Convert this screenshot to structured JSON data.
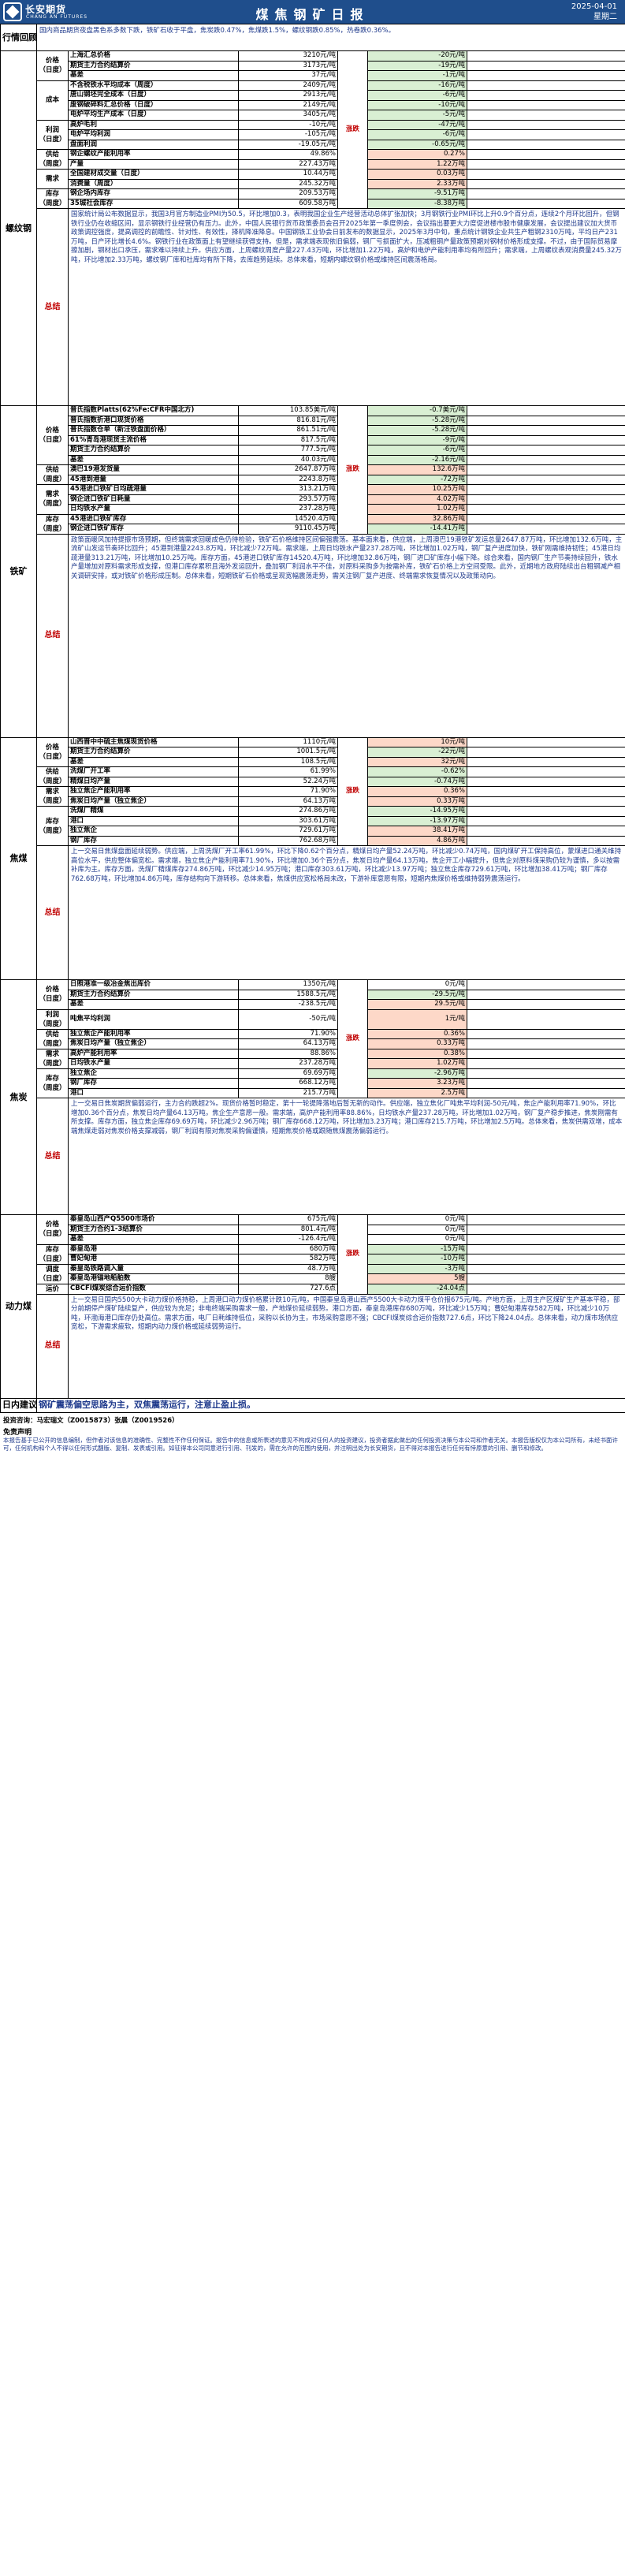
{
  "header": {
    "brand_cn": "长安期货",
    "brand_en": "CHANG AN FUTURES",
    "title": "煤焦钢矿日报",
    "date": "2025-04-01",
    "weekday": "星期二"
  },
  "review": {
    "label": "行情回顾",
    "text": "国内商品期货夜盘黑色系多数下跌，铁矿石收于平盘，焦炭跌0.47%，焦煤跌1.5%，螺纹钢跌0.85%，热卷跌0.36%。"
  },
  "sections": [
    {
      "name": "螺纹钢",
      "groups": [
        {
          "label": "价格\n（日度）",
          "rows": [
            {
              "ind": "上海汇总价格",
              "val": "3210元/吨",
              "chg": "-20元/吨",
              "dir": "down"
            },
            {
              "ind": "期货主力合约结算价",
              "val": "3173元/吨",
              "chg": "-19元/吨",
              "dir": "down"
            },
            {
              "ind": "基差",
              "val": "37元/吨",
              "chg": "-1元/吨",
              "dir": "down"
            }
          ]
        },
        {
          "label": "成本",
          "rows": [
            {
              "ind": "不含税铁水平均成本（周度）",
              "val": "2409元/吨",
              "chg": "-16元/吨",
              "dir": "down"
            },
            {
              "ind": "唐山钢坯完全成本（日度）",
              "val": "2913元/吨",
              "chg": "-6元/吨",
              "dir": "down"
            },
            {
              "ind": "废钢破碎料汇总价格（日度）",
              "val": "2149元/吨",
              "chg": "-10元/吨",
              "dir": "down"
            },
            {
              "ind": "电炉平均生产成本（日度）",
              "val": "3405元/吨",
              "chg": "-5元/吨",
              "dir": "down"
            }
          ]
        },
        {
          "label": "利润\n（日度）",
          "rows": [
            {
              "ind": "高炉毛利",
              "val": "-10元/吨",
              "chg": "-47元/吨",
              "dir": "down"
            },
            {
              "ind": "电炉平均利润",
              "val": "-105元/吨",
              "chg": "-6元/吨",
              "dir": "down"
            },
            {
              "ind": "盘面利润",
              "val": "-19.05元/吨",
              "chg": "-0.65元/吨",
              "dir": "down"
            }
          ]
        },
        {
          "label": "供给\n（周度）",
          "rows": [
            {
              "ind": "钢企螺纹产能利用率",
              "val": "49.86%",
              "chg": "0.27%",
              "dir": "up"
            },
            {
              "ind": "产量",
              "val": "227.43万吨",
              "chg": "1.22万吨",
              "dir": "up"
            }
          ]
        },
        {
          "label": "需求",
          "rows": [
            {
              "ind": "全国建材成交量（日度）",
              "val": "10.44万吨",
              "chg": "0.03万吨",
              "dir": "up"
            },
            {
              "ind": "消费量（周度）",
              "val": "245.32万吨",
              "chg": "2.33万吨",
              "dir": "up"
            }
          ]
        },
        {
          "label": "库存\n（周度）",
          "rows": [
            {
              "ind": "钢企场内库存",
              "val": "209.53万吨",
              "chg": "-9.51万吨",
              "dir": "down"
            },
            {
              "ind": "35城社会库存",
              "val": "609.58万吨",
              "chg": "-8.38万吨",
              "dir": "down"
            }
          ]
        }
      ],
      "summary": "国家统计局公布数据显示，我国3月官方制造业PMI为50.5，环比增加0.3，表明我国企业生产经营活动总体扩张加快；3月钢铁行业PMI环比上升0.9个百分点，连续2个月环比回升，但钢铁行业仍在收缩区间，显示钢铁行业经营仍有压力。此外，中国人民银行货币政策委员会召开2025年第一季度例会，会议指出要更大力度促进楼市股市健康发展，会议提出建议加大货币政策调控强度，提高调控的前瞻性、针对性、有效性，择机降准降息。中国钢铁工业协会日前发布的数据显示，2025年3月中旬，重点统计钢铁企业共生产粗钢2310万吨，平均日产231万吨，日产环比增长4.6%。钢铁行业在政策面上有望继续获得支持。但是，需求端表现依旧偏弱，钢厂亏损面扩大，压减粗钢产量政策预期对钢材价格形成支撑。不过，由于国际贸易摩擦加剧，钢材出口承压，需求难以持续上升。供应方面，上周螺纹周度产量227.43万吨，环比增加1.22万吨，高炉和电炉产能利用率均有所回升；需求端，上周螺纹表观消费量245.32万吨，环比增加2.33万吨，螺纹钢厂库和社库均有所下降，去库趋势延续。总体来看，短期内螺纹钢价格或维持区间震荡格局。",
      "summary_highlight": "总体来看，短期内螺纹钢价格或维持区间震荡格局。"
    },
    {
      "name": "铁矿",
      "groups": [
        {
          "label": "价格\n（日度）",
          "rows": [
            {
              "ind": "普氏指数Platts(62%Fe:CFR中国北方)",
              "val": "103.85美元/吨",
              "chg": "-0.7美元/吨",
              "dir": "down"
            },
            {
              "ind": "普氏指数折港口现货价格",
              "val": "816.81元/吨",
              "chg": "-5.28元/吨",
              "dir": "down"
            },
            {
              "ind": "普氏指数仓单（新汪铁盘面价格）",
              "val": "861.51元/吨",
              "chg": "-5.28元/吨",
              "dir": "down"
            },
            {
              "ind": "61%青岛港现货主流价格",
              "val": "817.5元/吨",
              "chg": "-9元/吨",
              "dir": "down"
            },
            {
              "ind": "期货主力合约结算价",
              "val": "777.5元/吨",
              "chg": "-6元/吨",
              "dir": "down"
            },
            {
              "ind": "基差",
              "val": "40.03元/吨",
              "chg": "-2.16元/吨",
              "dir": "down"
            }
          ]
        },
        {
          "label": "供给\n（周度）",
          "rows": [
            {
              "ind": "澳巴19港发货量",
              "val": "2647.87万吨",
              "chg": "132.6万吨",
              "dir": "up"
            },
            {
              "ind": "45港到港量",
              "val": "2243.8万吨",
              "chg": "-72万吨",
              "dir": "down"
            }
          ]
        },
        {
          "label": "需求\n（周度）",
          "rows": [
            {
              "ind": "45港进口铁矿日均疏港量",
              "val": "313.21万吨",
              "chg": "10.25万吨",
              "dir": "up"
            },
            {
              "ind": "钢企进口铁矿日耗量",
              "val": "293.57万吨",
              "chg": "4.02万吨",
              "dir": "up"
            },
            {
              "ind": "日均铁水产量",
              "val": "237.28万吨",
              "chg": "1.02万吨",
              "dir": "up"
            }
          ]
        },
        {
          "label": "库存\n（周度）",
          "rows": [
            {
              "ind": "45港进口铁矿库存",
              "val": "14520.4万吨",
              "chg": "32.86万吨",
              "dir": "up"
            },
            {
              "ind": "钢企进口铁矿库存",
              "val": "9110.45万吨",
              "chg": "-14.41万吨",
              "dir": "down"
            }
          ]
        }
      ],
      "summary": "政策面暖风加持提振市场预期，但终端需求回暖成色仍待检验，铁矿石价格维持区间偏强震荡。基本面来看，供应端，上周澳巴19港铁矿发运总量2647.87万吨，环比增加132.6万吨，主流矿山发运节奏环比回升；45港到港量2243.8万吨，环比减少72万吨。需求端，上周日均铁水产量237.28万吨，环比增加1.02万吨，钢厂复产进度加快，铁矿刚需维持韧性；45港日均疏港量313.21万吨，环比增加10.25万吨。库存方面，45港进口铁矿库存14520.4万吨，环比增加32.86万吨，钢厂进口矿库存小幅下降。综合来看，国内钢厂生产节奏持续回升，铁水产量增加对原料需求形成支撑，但港口库存累积且海外发运回升，叠加钢厂利润水平不佳，对原料采购多为按需补库，铁矿石价格上方空间受限。此外，近期地方政府陆续出台粗钢减产相关调研安排，或对铁矿价格形成压制。总体来看，短期铁矿石价格或呈现宽幅震荡走势，需关注钢厂复产进度、终端需求恢复情况以及政策动向。",
      "summary_highlight": "总体来看，短期铁矿石价格或呈现宽幅震荡走势，需关注钢厂复产进度、终端需求恢复情况以及政策动向。"
    },
    {
      "name": "焦煤",
      "groups": [
        {
          "label": "价格\n（日度）",
          "rows": [
            {
              "ind": "山西晋中中硫主焦煤现货价格",
              "val": "1110元/吨",
              "chg": "10元/吨",
              "dir": "up"
            },
            {
              "ind": "期货主力合约结算价",
              "val": "1001.5元/吨",
              "chg": "-22元/吨",
              "dir": "down"
            },
            {
              "ind": "基差",
              "val": "108.5元/吨",
              "chg": "32元/吨",
              "dir": "up"
            }
          ]
        },
        {
          "label": "供给\n（周度）",
          "rows": [
            {
              "ind": "洗煤厂开工率",
              "val": "61.99%",
              "chg": "-0.62%",
              "dir": "down"
            },
            {
              "ind": "精煤日均产量",
              "val": "52.24万吨",
              "chg": "-0.74万吨",
              "dir": "down"
            }
          ]
        },
        {
          "label": "需求\n（周度）",
          "rows": [
            {
              "ind": "独立焦企产能利用率",
              "val": "71.90%",
              "chg": "0.36%",
              "dir": "up"
            },
            {
              "ind": "焦炭日均产量（独立焦企）",
              "val": "64.13万吨",
              "chg": "0.33万吨",
              "dir": "up"
            }
          ]
        },
        {
          "label": "库存\n（周度）",
          "rows": [
            {
              "ind": "洗煤厂精煤",
              "val": "274.86万吨",
              "chg": "-14.95万吨",
              "dir": "down"
            },
            {
              "ind": "港口",
              "val": "303.61万吨",
              "chg": "-13.97万吨",
              "dir": "down"
            },
            {
              "ind": "独立焦企",
              "val": "729.61万吨",
              "chg": "38.41万吨",
              "dir": "up"
            },
            {
              "ind": "钢厂库存",
              "val": "762.68万吨",
              "chg": "4.86万吨",
              "dir": "up"
            }
          ]
        }
      ],
      "summary": "上一交易日焦煤盘面延续弱势。供应端，上周洗煤厂开工率61.99%，环比下降0.62个百分点，精煤日均产量52.24万吨，环比减少0.74万吨，国内煤矿开工保持高位，蒙煤进口通关维持高位水平，供应整体偏宽松。需求端，独立焦企产能利用率71.90%，环比增加0.36个百分点，焦炭日均产量64.13万吨，焦企开工小幅提升，但焦企对原料煤采购仍较为谨慎，多以按需补库为主。库存方面，洗煤厂精煤库存274.86万吨，环比减少14.95万吨；港口库存303.61万吨，环比减少13.97万吨；独立焦企库存729.61万吨，环比增加38.41万吨；钢厂库存762.68万吨，环比增加4.86万吨，库存结构向下游转移。总体来看，焦煤供应宽松格局未改，下游补库意愿有限，短期内焦煤价格或维持弱势震荡运行。",
      "summary_highlight": "总体来看，焦煤供应宽松格局未改，下游补库意愿有限，短期内焦煤价格或维持弱势震荡运行。"
    },
    {
      "name": "焦炭",
      "groups": [
        {
          "label": "价格\n（日度）",
          "rows": [
            {
              "ind": "日照港准一级冶金焦出库价",
              "val": "1350元/吨",
              "chg": "0元/吨",
              "dir": "flat"
            },
            {
              "ind": "期货主力合约结算价",
              "val": "1588.5元/吨",
              "chg": "-29.5元/吨",
              "dir": "down"
            },
            {
              "ind": "基差",
              "val": "-238.5元/吨",
              "chg": "29.5元/吨",
              "dir": "up"
            }
          ]
        },
        {
          "label": "利润\n（周度）",
          "rows": [
            {
              "ind": "吨焦平均利润",
              "val": "-50元/吨",
              "chg": "1元/吨",
              "dir": "up"
            }
          ]
        },
        {
          "label": "供给\n（周度）",
          "rows": [
            {
              "ind": "独立焦企产能利用率",
              "val": "71.90%",
              "chg": "0.36%",
              "dir": "up"
            },
            {
              "ind": "焦炭日均产量（独立焦企）",
              "val": "64.13万吨",
              "chg": "0.33万吨",
              "dir": "up"
            }
          ]
        },
        {
          "label": "需求\n（周度）",
          "rows": [
            {
              "ind": "高炉产能利用率",
              "val": "88.86%",
              "chg": "0.38%",
              "dir": "up"
            },
            {
              "ind": "日均铁水产量",
              "val": "237.28万吨",
              "chg": "1.02万吨",
              "dir": "up"
            }
          ]
        },
        {
          "label": "库存\n（周度）",
          "rows": [
            {
              "ind": "独立焦企",
              "val": "69.69万吨",
              "chg": "-2.96万吨",
              "dir": "down"
            },
            {
              "ind": "钢厂库存",
              "val": "668.12万吨",
              "chg": "3.23万吨",
              "dir": "up"
            },
            {
              "ind": "港口",
              "val": "215.7万吨",
              "chg": "2.5万吨",
              "dir": "up"
            }
          ]
        }
      ],
      "summary": "上一交易日焦炭期货偏弱运行，主力合约跌超2%。现货价格暂时稳定，第十一轮提降落地后暂无新的动作。供应端，独立焦化厂吨焦平均利润-50元/吨，焦企产能利用率71.90%，环比增加0.36个百分点，焦炭日均产量64.13万吨，焦企生产意愿一般。需求端，高炉产能利用率88.86%，日均铁水产量237.28万吨，环比增加1.02万吨，钢厂复产稳步推进，焦炭刚需有所支撑。库存方面，独立焦企库存69.69万吨，环比减少2.96万吨；钢厂库存668.12万吨，环比增加3.23万吨；港口库存215.7万吨，环比增加2.5万吨。总体来看，焦炭供需双增，成本端焦煤走弱对焦炭价格支撑减弱，钢厂利润有限对焦炭采购偏谨慎，短期焦炭价格或跟随焦煤震荡偏弱运行。",
      "summary_highlight": "总体来看，短期焦炭价格或跟随焦煤震荡偏弱运行。"
    },
    {
      "name": "动力煤",
      "groups": [
        {
          "label": "价格\n（日度）",
          "rows": [
            {
              "ind": "秦皇岛山西产Q5500市场价",
              "val": "675元/吨",
              "chg": "0元/吨",
              "dir": "flat"
            },
            {
              "ind": "期货主力合约1-3结算价",
              "val": "801.4元/吨",
              "chg": "0元/吨",
              "dir": "flat"
            },
            {
              "ind": "基差",
              "val": "-126.4元/吨",
              "chg": "0元/吨",
              "dir": "flat"
            }
          ]
        },
        {
          "label": "库存\n（日度）",
          "rows": [
            {
              "ind": "秦皇岛港",
              "val": "680万吨",
              "chg": "-15万吨",
              "dir": "down"
            },
            {
              "ind": "曹妃甸港",
              "val": "582万吨",
              "chg": "-10万吨",
              "dir": "down"
            }
          ]
        },
        {
          "label": "调度\n（日度）",
          "rows": [
            {
              "ind": "秦皇岛铁路调入量",
              "val": "48.7万吨",
              "chg": "-3万吨",
              "dir": "down"
            },
            {
              "ind": "秦皇岛港锚地船舶数",
              "val": "8艘",
              "chg": "5艘",
              "dir": "up"
            }
          ]
        },
        {
          "label": "运价",
          "rows": [
            {
              "ind": "CBCFI煤炭综合运价指数",
              "val": "727.6点",
              "chg": "-24.04点",
              "dir": "down"
            }
          ]
        }
      ],
      "summary": "上一交易日国内5500大卡动力煤价格持稳，上周港口动力煤价格累计跌10元/吨，中国秦皇岛港山西产5500大卡动力煤平仓价报675元/吨。产地方面，上周主产区煤矿生产基本平稳，部分前期停产煤矿陆续复产，供应较为充足；非电终端采购需求一般，产地煤价延续弱势。港口方面，秦皇岛港库存680万吨，环比减少15万吨；曹妃甸港库存582万吨，环比减少10万吨，环渤海港口库存仍处高位。需求方面，电厂日耗维持低位，采购以长协为主，市场采购意愿不强；CBCFI煤炭综合运价指数727.6点，环比下降24.04点。总体来看，动力煤市场供应宽松，下游需求疲软，短期内动力煤价格或延续弱势运行。",
      "summary_highlight": "总体来看，短期内动力煤价格或延续弱势运行。"
    }
  ],
  "labels": {
    "zhangdie": "涨跌",
    "summary": "总结",
    "advice_label": "日内建议",
    "advice": "钢矿震荡偏空思路为主，双焦震荡运行，注意止盈止损。"
  },
  "footer": {
    "analyst": "投资咨询：马宏瑞文（Z0015873）张晨（Z0019526）",
    "disclaimer_title": "免责声明",
    "disclaimer": "本报告基于已公开的信息编制，但作者对该信息的准确性、完整性不作任何保证。报告中的信息或所表述的意见不构成对任何人的投资建议，投资者据此做出的任何投资决策与本公司和作者无关。本报告版权仅为本公司所有，未经书面许可，任何机构和个人不得以任何形式翻版、复制、发表或引用。如征得本公司同意进行引用、刊发的，需在允许的范围内使用，并注明出处为长安期货，且不得对本报告进行任何有悖原意的引用、删节和修改。"
  },
  "colors": {
    "brand": "#1f4e8c",
    "up_bg": "#fdd8c8",
    "down_bg": "#d9efd3",
    "summary_text": "#1f3a8c",
    "label_red": "#c00000"
  }
}
